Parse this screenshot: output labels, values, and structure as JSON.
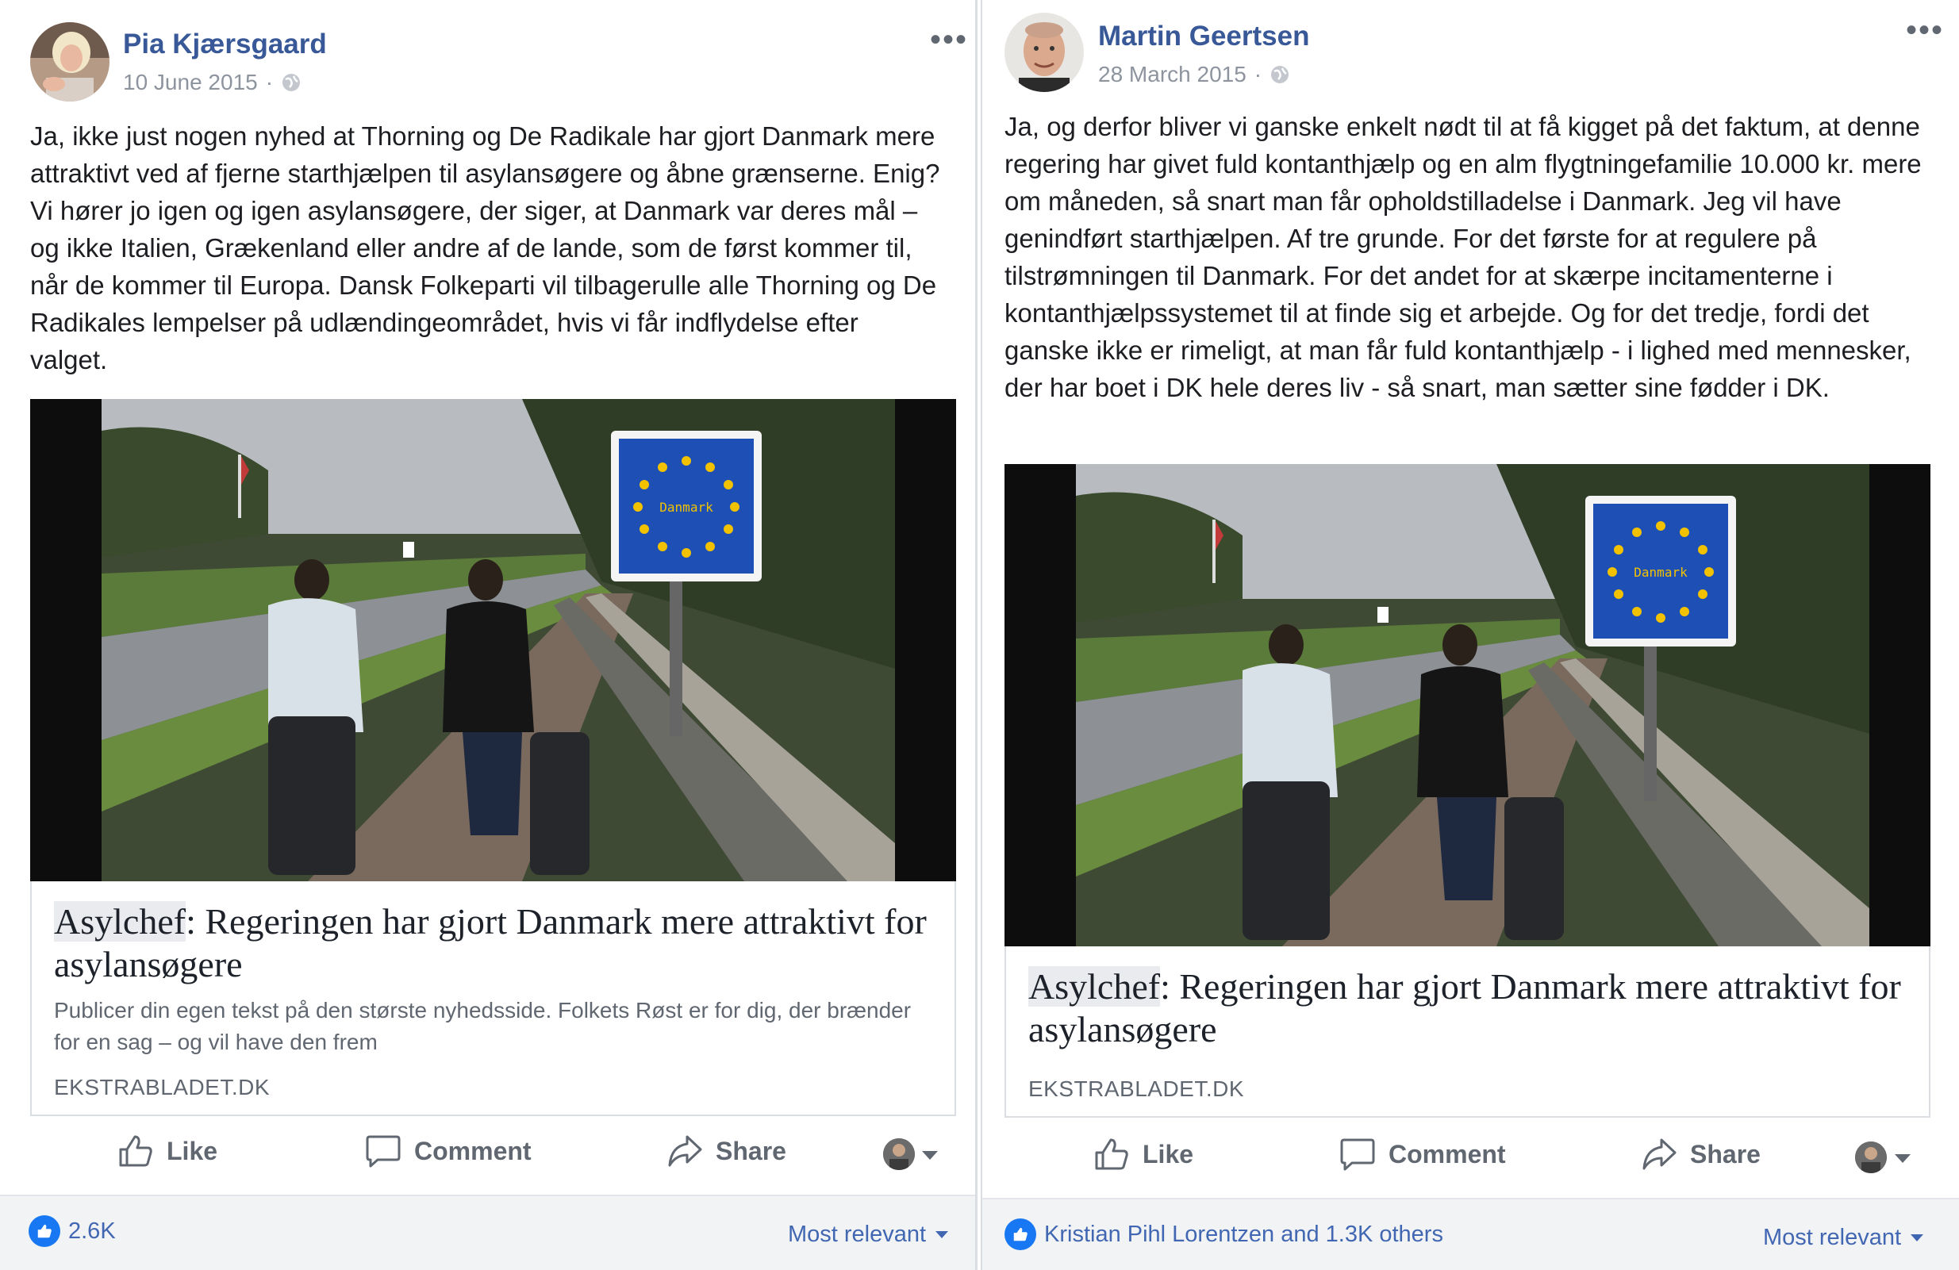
{
  "posts": [
    {
      "author": "Pia Kjærsgaard",
      "date": "10 June 2015",
      "date_sep": "·",
      "text": "Ja, ikke just nogen nyhed at Thorning og De Radikale har gjort Danmark mere attraktivt ved af fjerne starthjælpen til asylansøgere og åbne grænserne. Enig? Vi hører jo igen og igen asylansøgere, der siger, at Danmark var deres mål – og ikke Italien, Grækenland eller andre af de lande, som de først kommer til, når de kommer til Europa. Dansk Folkeparti vil tilbagerulle alle Thorning og De Radikales lempelser på udlændingeområdet, hvis vi får indflydelse efter valget.",
      "link": {
        "title_highlight": "Asylchef",
        "title_rest": ": Regeringen har gjort Danmark mere attraktivt for asylansøgere",
        "description": "Publicer din egen tekst på den største nyhedsside. Folkets Røst er for dig, der brænder for en sag – og vil have den frem",
        "domain": "EKSTRABLADET.DK",
        "sign_text": "Danmark"
      },
      "actions": {
        "like": "Like",
        "comment": "Comment",
        "share": "Share"
      },
      "reactions": "2.6K",
      "sort": "Most relevant"
    },
    {
      "author": "Martin Geertsen",
      "date": "28 March 2015",
      "date_sep": "·",
      "text": "Ja, og derfor bliver vi ganske enkelt nødt til at få kigget på det faktum, at denne regering har givet fuld kontanthjælp og en alm flygtningefamilie 10.000 kr. mere om måneden, så snart man får opholdstilladelse i Danmark. Jeg vil have genindført starthjælpen. Af tre grunde. For det første for at regulere på tilstrømningen til Danmark. For det andet for at skærpe incitamenterne i kontanthjælpssystemet til at finde sig et arbejde. Og for det tredje, fordi det ganske ikke er rimeligt, at man får fuld kontanthjælp - i lighed med mennesker, der har boet i DK hele deres liv - så snart, man sætter sine fødder i DK.",
      "link": {
        "title_highlight": "Asylchef",
        "title_rest": ": Regeringen har gjort Danmark mere attraktivt for asylansøgere",
        "domain": "EKSTRABLADET.DK",
        "sign_text": "Danmark"
      },
      "actions": {
        "like": "Like",
        "comment": "Comment",
        "share": "Share"
      },
      "reactions": "Kristian Pihl Lorentzen and 1.3K others",
      "sort": "Most relevant"
    }
  ],
  "icons": {
    "more": "more-options-icon",
    "privacy": "globe-icon",
    "like": "thumbs-up-icon",
    "comment": "speech-bubble-icon",
    "share": "share-arrow-icon"
  },
  "colors": {
    "author_link": "#385898",
    "meta_text": "#8d949e",
    "like_badge": "#1877f2",
    "footer_bg": "#f2f3f5"
  }
}
